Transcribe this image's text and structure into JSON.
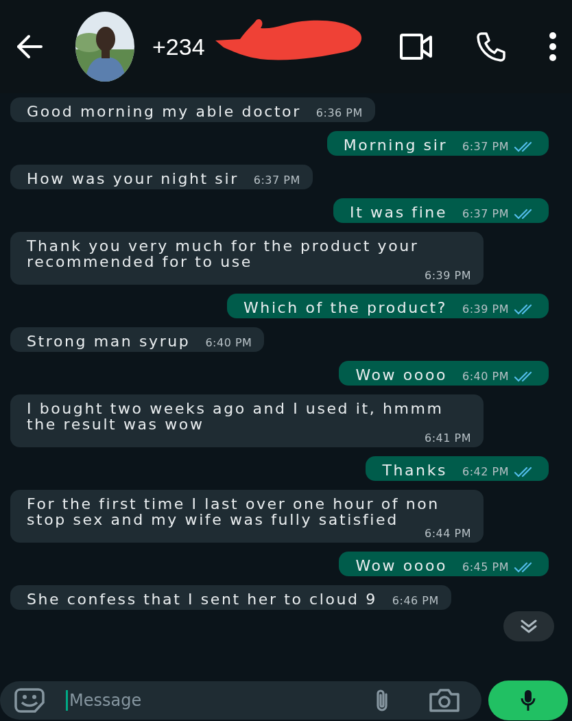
{
  "header": {
    "contact": "+234"
  },
  "messages": [
    {
      "kind": "incoming",
      "text": "Good morning my able doctor",
      "time": "6:36 PM"
    },
    {
      "kind": "outgoing",
      "text": "Morning sir",
      "time": "6:37 PM",
      "read": true
    },
    {
      "kind": "incoming",
      "text": "How was your night sir",
      "time": "6:37 PM"
    },
    {
      "kind": "outgoing",
      "text": "It was fine",
      "time": "6:37 PM",
      "read": true
    },
    {
      "kind": "incoming",
      "text": "Thank you very much for the product your recommended for to use",
      "time": "6:39 PM"
    },
    {
      "kind": "outgoing",
      "text": "Which of the product?",
      "time": "6:39 PM",
      "read": true
    },
    {
      "kind": "incoming",
      "text": "Strong man syrup",
      "time": "6:40 PM"
    },
    {
      "kind": "outgoing",
      "text": "Wow oooo",
      "time": "6:40 PM",
      "read": true
    },
    {
      "kind": "incoming",
      "text": "I bought two weeks ago and I used it, hmmm the result was wow",
      "time": "6:41 PM"
    },
    {
      "kind": "outgoing",
      "text": "Thanks",
      "time": "6:42 PM",
      "read": true
    },
    {
      "kind": "incoming",
      "text": "For the first time I last over one hour of non stop sex and my wife was fully satisfied",
      "time": "6:44 PM"
    },
    {
      "kind": "outgoing",
      "text": "Wow oooo",
      "time": "6:45 PM",
      "read": true
    },
    {
      "kind": "incoming",
      "text": "She confess that I sent her to cloud 9",
      "time": "6:46 PM"
    }
  ],
  "composer": {
    "placeholder": "Message"
  }
}
